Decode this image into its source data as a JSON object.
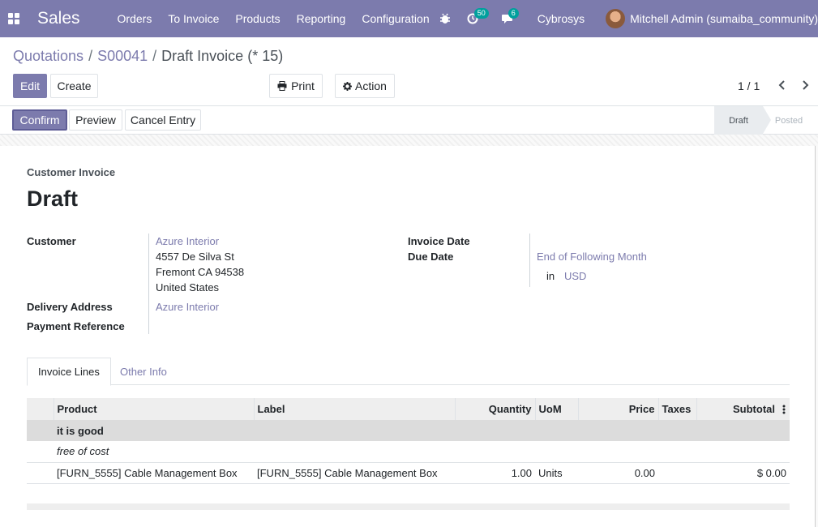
{
  "navbar": {
    "app_name": "Sales",
    "menu": [
      "Orders",
      "To Invoice",
      "Products",
      "Reporting",
      "Configuration"
    ],
    "activity_count": "50",
    "message_count": "6",
    "company": "Cybrosys",
    "user": "Mitchell Admin (sumaiba_community)",
    "bg_color": "#7c7bad"
  },
  "breadcrumb": {
    "items": [
      "Quotations",
      "S00041"
    ],
    "current": "Draft Invoice (* 15)"
  },
  "toolbar": {
    "edit": "Edit",
    "create": "Create",
    "print": "Print",
    "action": "Action",
    "pager": "1 / 1"
  },
  "statusbar": {
    "confirm": "Confirm",
    "preview": "Preview",
    "cancel": "Cancel Entry",
    "stages": [
      "Draft",
      "Posted"
    ]
  },
  "form": {
    "doc_type": "Customer Invoice",
    "title": "Draft",
    "customer_label": "Customer",
    "customer_name": "Azure Interior",
    "address_line1": "4557 De Silva St",
    "address_line2": "Fremont CA 94538",
    "address_line3": "United States",
    "delivery_label": "Delivery Address",
    "delivery_value": "Azure Interior",
    "payment_ref_label": "Payment Reference",
    "invoice_date_label": "Invoice Date",
    "due_date_label": "Due Date",
    "due_date_value": "End of Following Month",
    "currency_prefix": "in",
    "currency": "USD"
  },
  "tabs": [
    "Invoice Lines",
    "Other Info"
  ],
  "table": {
    "headers": [
      "Product",
      "Label",
      "Quantity",
      "UoM",
      "Price",
      "Taxes",
      "Subtotal"
    ],
    "section": "it is good",
    "note": "free of cost",
    "line": {
      "product": "[FURN_5555] Cable Management Box",
      "label": "[FURN_5555] Cable Management Box",
      "quantity": "1.00",
      "uom": "Units",
      "price": "0.00",
      "taxes": "",
      "subtotal": "$ 0.00"
    }
  }
}
